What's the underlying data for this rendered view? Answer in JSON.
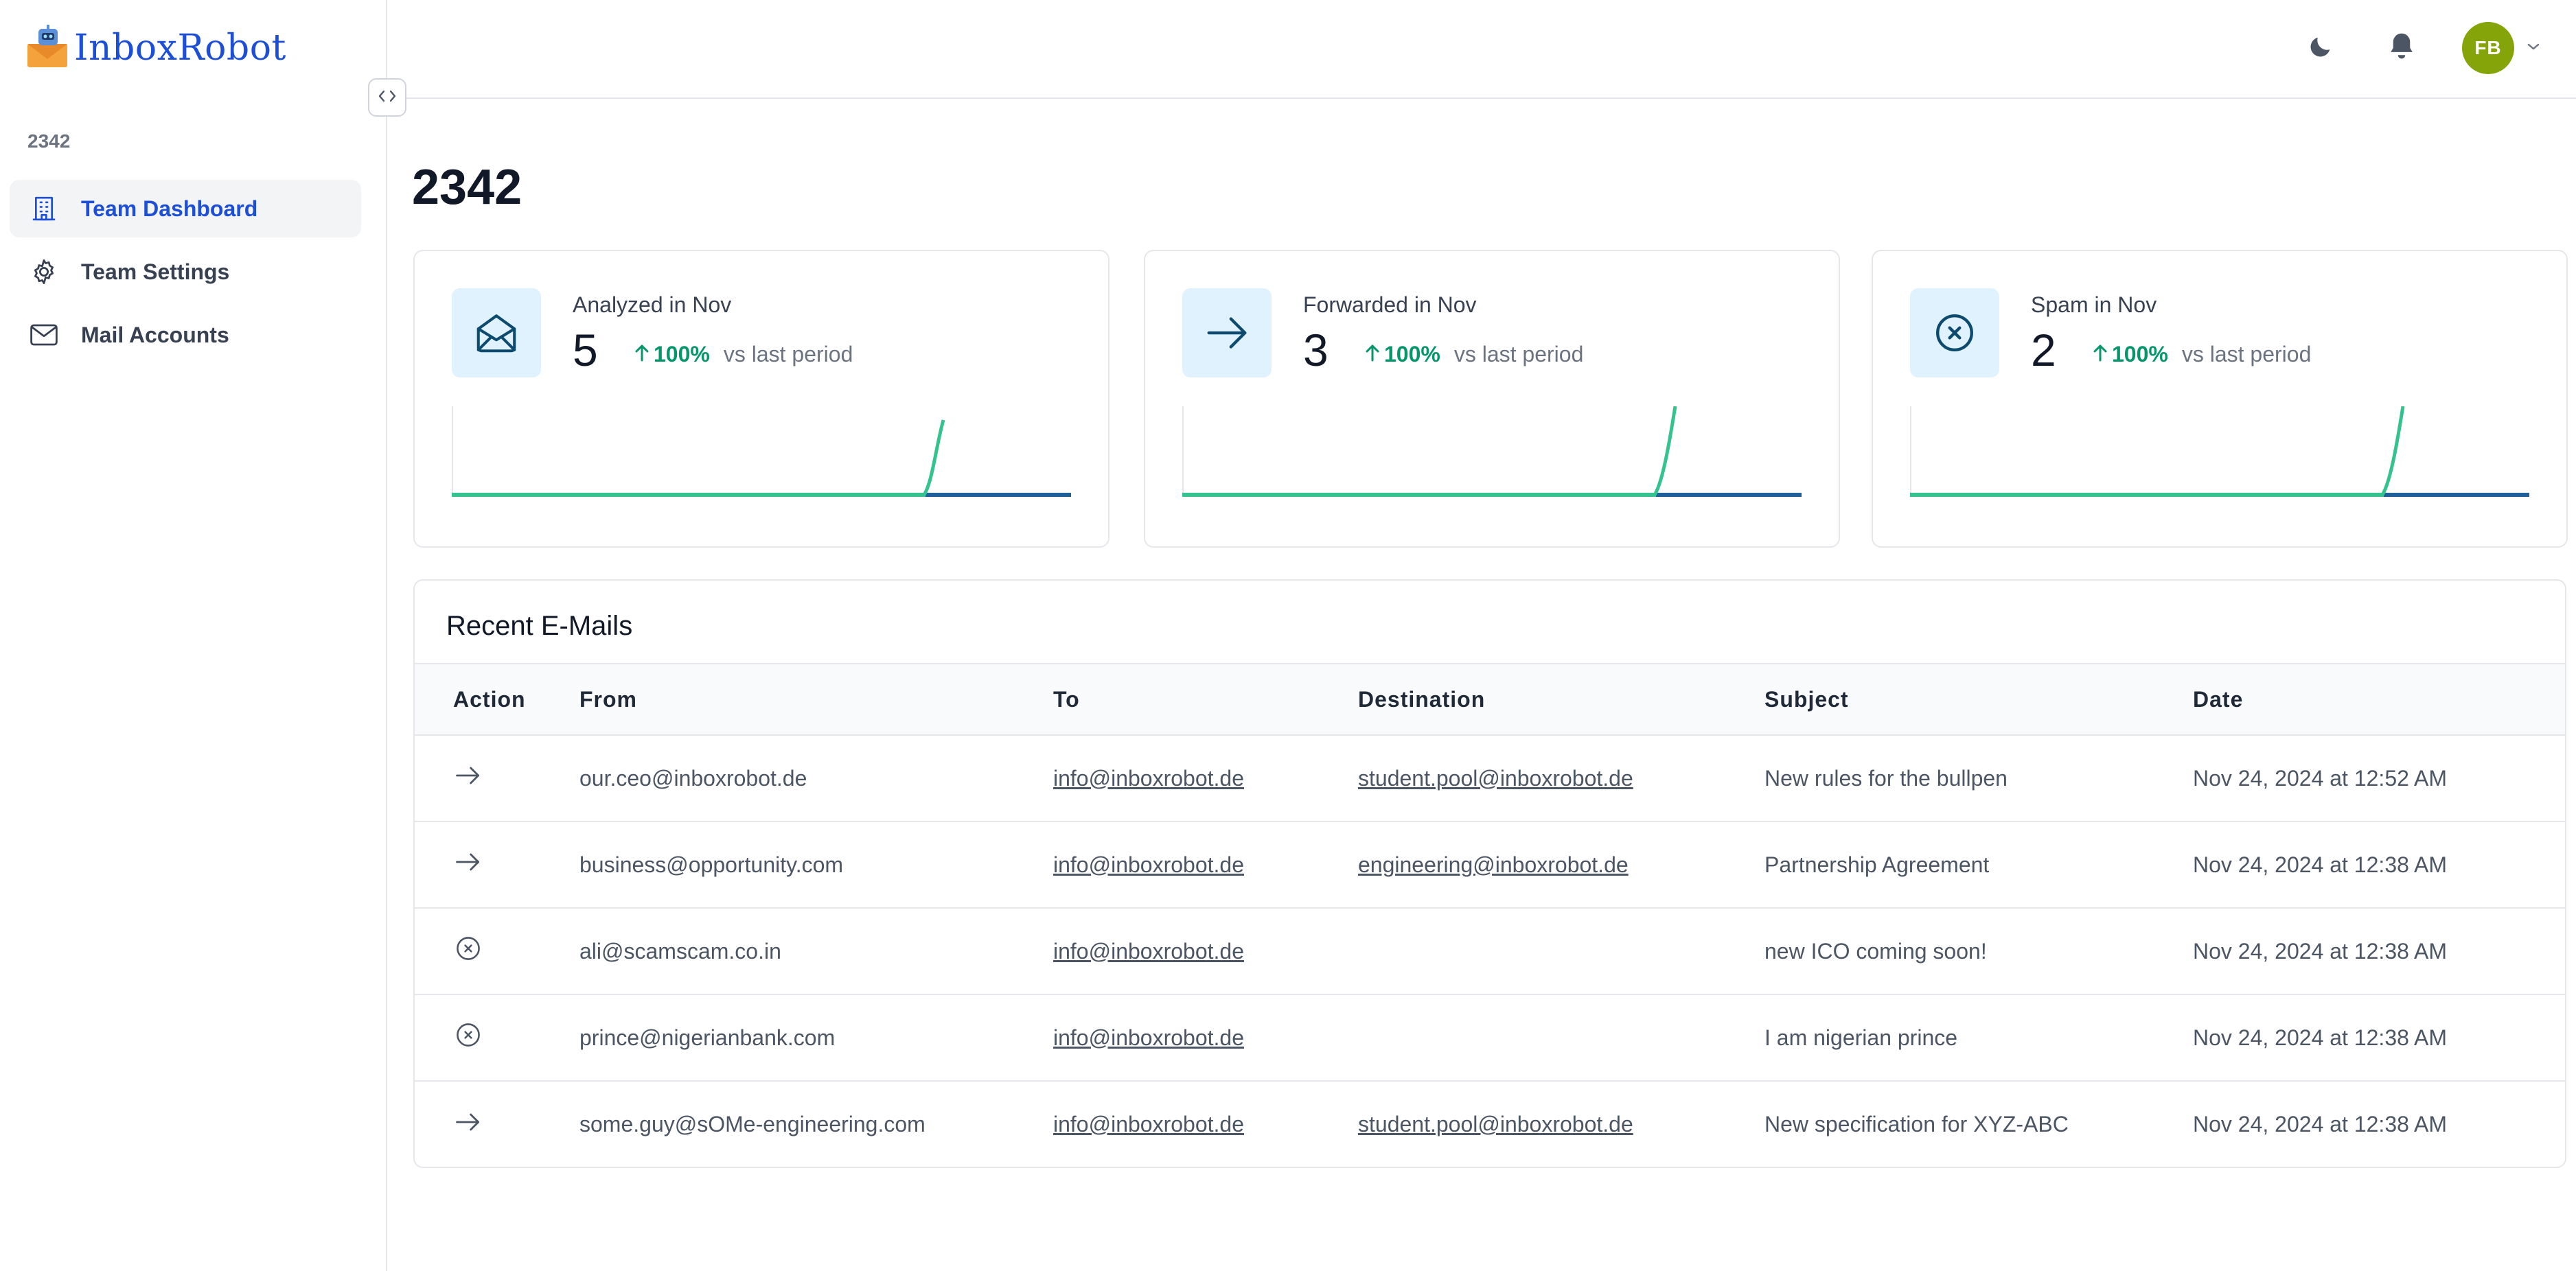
{
  "app": {
    "logo_text": "InboxRobot",
    "org_label": "2342"
  },
  "sidebar": {
    "items": [
      {
        "label": "Team Dashboard",
        "icon": "building-icon",
        "active": true
      },
      {
        "label": "Team Settings",
        "icon": "gear-icon",
        "active": false
      },
      {
        "label": "Mail Accounts",
        "icon": "envelope-icon",
        "active": false
      }
    ]
  },
  "topbar": {
    "avatar_initials": "FB"
  },
  "main": {
    "title": "2342"
  },
  "cards": [
    {
      "label": "Analyzed in Nov",
      "value": "5",
      "trend": "100%",
      "note": "vs last period",
      "icon": "envelope-open-icon"
    },
    {
      "label": "Forwarded in Nov",
      "value": "3",
      "trend": "100%",
      "note": "vs last period",
      "icon": "arrow-right-icon"
    },
    {
      "label": "Spam in Nov",
      "value": "2",
      "trend": "100%",
      "note": "vs last period",
      "icon": "x-circle-icon"
    }
  ],
  "recent": {
    "title": "Recent E-Mails",
    "columns": [
      "Action",
      "From",
      "To",
      "Destination",
      "Subject",
      "Date"
    ],
    "rows": [
      {
        "action": "forward",
        "from": "our.ceo@inboxrobot.de",
        "to": "info@inboxrobot.de",
        "destination": "student.pool@inboxrobot.de",
        "subject": "New rules for the bullpen",
        "date": "Nov 24, 2024 at 12:52 AM"
      },
      {
        "action": "forward",
        "from": "business@opportunity.com",
        "to": "info@inboxrobot.de",
        "destination": "engineering@inboxrobot.de",
        "subject": "Partnership Agreement",
        "date": "Nov 24, 2024 at 12:38 AM"
      },
      {
        "action": "spam",
        "from": "ali@scamscam.co.in",
        "to": "info@inboxrobot.de",
        "destination": "",
        "subject": "new ICO coming soon!",
        "date": "Nov 24, 2024 at 12:38 AM"
      },
      {
        "action": "spam",
        "from": "prince@nigerianbank.com",
        "to": "info@inboxrobot.de",
        "destination": "",
        "subject": "I am nigerian prince",
        "date": "Nov 24, 2024 at 12:38 AM"
      },
      {
        "action": "forward",
        "from": "some.guy@sOMe-engineering.com",
        "to": "info@inboxrobot.de",
        "destination": "student.pool@inboxrobot.de",
        "subject": "New specification for XYZ-ABC",
        "date": "Nov 24, 2024 at 12:38 AM"
      }
    ]
  },
  "colors": {
    "accent": "#1d4ed8",
    "trend_up": "#059669",
    "spark_green": "#34c38f",
    "spark_blue": "#1e5f99",
    "avatar_bg": "#84a40a"
  }
}
